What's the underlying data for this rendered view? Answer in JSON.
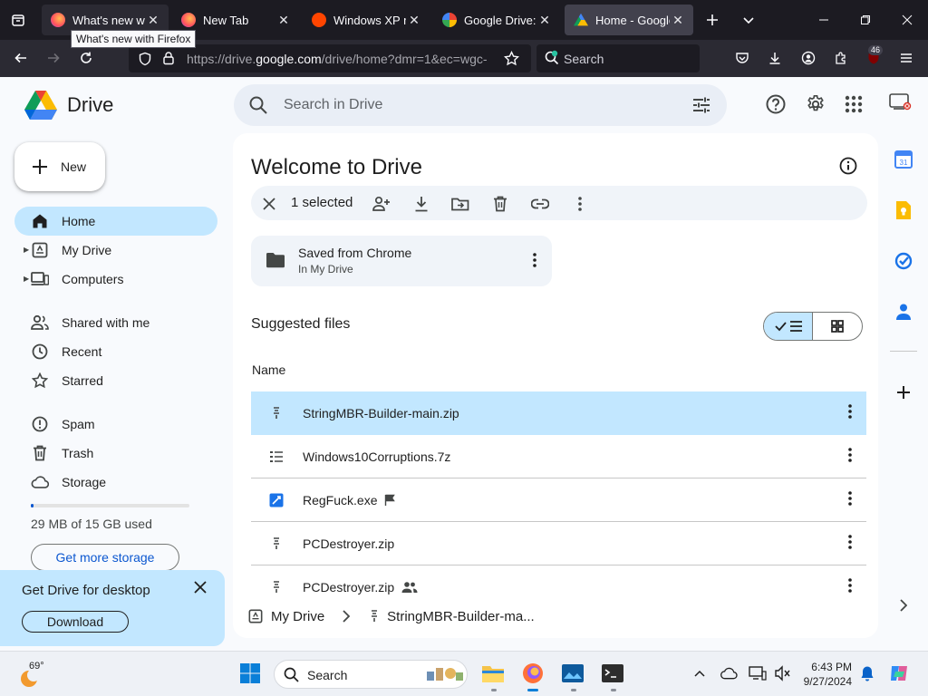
{
  "browser": {
    "tabs": [
      {
        "title": "What's new with Firefox",
        "favicon": "firefox-icon"
      },
      {
        "title": "New Tab",
        "favicon": "firefox-icon"
      },
      {
        "title": "Windows XP ma",
        "favicon": "reddit-icon"
      },
      {
        "title": "Google Drive: Sh",
        "favicon": "google-icon"
      },
      {
        "title": "Home - Google",
        "favicon": "drive-icon"
      }
    ],
    "tooltip": "What's new with Firefox",
    "url_prefix": "https://drive.",
    "url_domain": "google.com",
    "url_suffix": "/drive/home?dmr=1&ec=wgc-",
    "search_placeholder": "Search",
    "extension_badge": "46"
  },
  "drive": {
    "logo_text": "Drive",
    "search_placeholder": "Search in Drive",
    "new_label": "New",
    "nav": [
      {
        "label": "Home",
        "icon": "home-icon",
        "active": true
      },
      {
        "label": "My Drive",
        "icon": "my-drive-icon",
        "expandable": true
      },
      {
        "label": "Computers",
        "icon": "computers-icon",
        "expandable": true
      },
      {
        "label": "Shared with me",
        "icon": "shared-icon"
      },
      {
        "label": "Recent",
        "icon": "recent-icon"
      },
      {
        "label": "Starred",
        "icon": "star-icon"
      },
      {
        "label": "Spam",
        "icon": "spam-icon"
      },
      {
        "label": "Trash",
        "icon": "trash-icon"
      },
      {
        "label": "Storage",
        "icon": "cloud-icon"
      }
    ],
    "storage_text": "29 MB of 15 GB used",
    "storage_fraction": 0.002,
    "get_storage_label": "Get more storage",
    "promo": {
      "title": "Get Drive for desktop",
      "button": "Download"
    },
    "welcome_title": "Welcome to Drive",
    "selection_count": "1 selected",
    "folder_card": {
      "name": "Saved from Chrome",
      "location": "In My Drive"
    },
    "suggested_title": "Suggested files",
    "column_name": "Name",
    "files": [
      {
        "name": "StringMBR-Builder-main.zip",
        "icon": "zip-icon",
        "selected": true
      },
      {
        "name": "Windows10Corruptions.7z",
        "icon": "archive-list-icon"
      },
      {
        "name": "RegFuck.exe",
        "icon": "exe-icon",
        "tag": "flag-icon"
      },
      {
        "name": "PCDestroyer.zip",
        "icon": "zip-icon"
      },
      {
        "name": "PCDestroyer.zip",
        "icon": "zip-icon",
        "tag": "shared-people-icon"
      }
    ],
    "path": {
      "root": "My Drive",
      "file": "StringMBR-Builder-ma..."
    },
    "colors": {
      "accent": "#c2e7ff",
      "primary": "#0b57d0",
      "surface": "#f8fafd"
    }
  },
  "taskbar": {
    "temperature": "69°",
    "search_placeholder": "Search",
    "time": "6:43 PM",
    "date": "9/27/2024"
  }
}
